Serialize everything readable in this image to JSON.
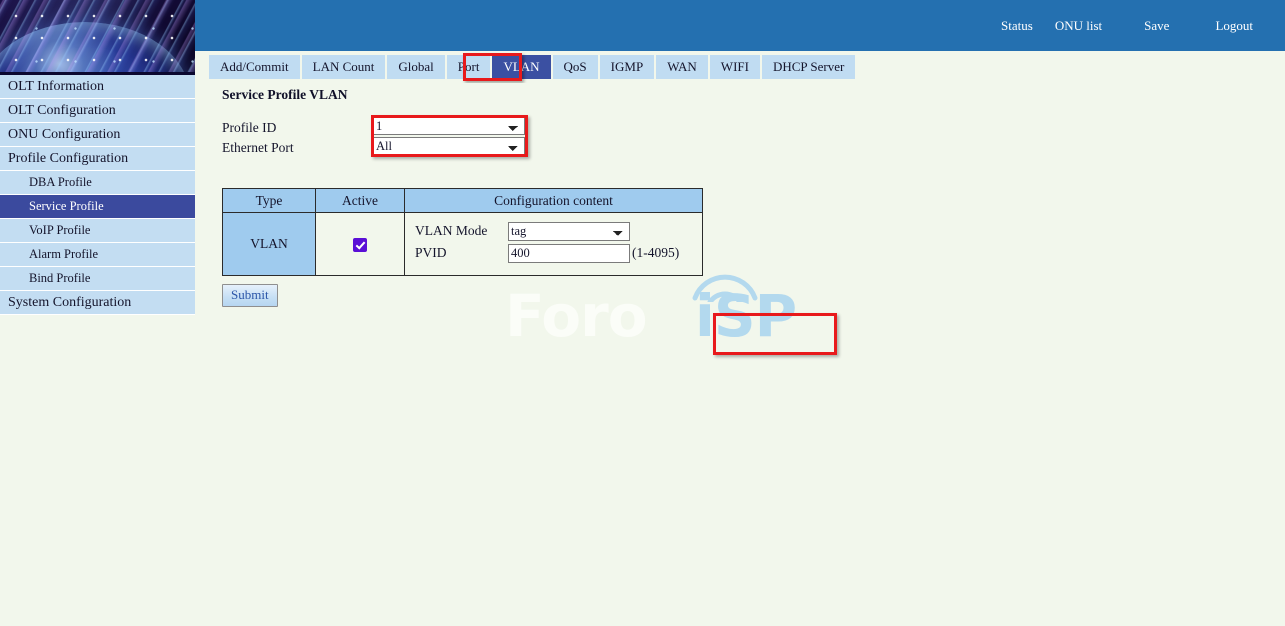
{
  "colors": {
    "header_blue": "#2470b0",
    "tab_blue": "#c0dcf2",
    "tab_active": "#3b50a2",
    "sidebar_blue": "#c3ddf2",
    "sidebar_selected": "#3b4a9e",
    "highlight_red": "#e8191b",
    "page_bg": "#f2f7ec",
    "table_header_blue": "#9fcbee",
    "checkbox_purple": "#5a0fd6",
    "watermark_blue": "#b3d9ee"
  },
  "banner": {
    "icon": "globe-fiber-banner-image"
  },
  "sidebar": {
    "items": [
      {
        "label": "OLT Information",
        "level": "top",
        "selected": false
      },
      {
        "label": "OLT Configuration",
        "level": "top",
        "selected": false
      },
      {
        "label": "ONU Configuration",
        "level": "top",
        "selected": false
      },
      {
        "label": "Profile Configuration",
        "level": "top",
        "selected": false
      },
      {
        "label": "DBA Profile",
        "level": "sub",
        "selected": false
      },
      {
        "label": "Service Profile",
        "level": "sub",
        "selected": true
      },
      {
        "label": "VoIP Profile",
        "level": "sub",
        "selected": false
      },
      {
        "label": "Alarm Profile",
        "level": "sub",
        "selected": false
      },
      {
        "label": "Bind Profile",
        "level": "sub",
        "selected": false
      },
      {
        "label": "System Configuration",
        "level": "top",
        "selected": false
      }
    ]
  },
  "header": {
    "links": [
      {
        "label": "Status"
      },
      {
        "label": "ONU list"
      },
      {
        "label": "Save"
      },
      {
        "label": "Logout"
      }
    ]
  },
  "tabs": [
    {
      "label": "Add/Commit",
      "active": false
    },
    {
      "label": "LAN Count",
      "active": false
    },
    {
      "label": "Global",
      "active": false
    },
    {
      "label": "Port",
      "active": false
    },
    {
      "label": "VLAN",
      "active": true
    },
    {
      "label": "QoS",
      "active": false
    },
    {
      "label": "IGMP",
      "active": false
    },
    {
      "label": "WAN",
      "active": false
    },
    {
      "label": "WIFI",
      "active": false
    },
    {
      "label": "DHCP Server",
      "active": false
    }
  ],
  "main": {
    "page_title": "Service Profile VLAN",
    "form": {
      "profile_id": {
        "label": "Profile ID",
        "value": "1",
        "options": [
          "1"
        ]
      },
      "ethernet_port": {
        "label": "Ethernet Port",
        "value": "All",
        "options": [
          "All"
        ]
      }
    },
    "table": {
      "columns": [
        "Type",
        "Active",
        "Configuration content"
      ],
      "row": {
        "type": "VLAN",
        "active": true,
        "config": {
          "vlan_mode": {
            "label": "VLAN Mode",
            "value": "tag",
            "options": [
              "tag"
            ]
          },
          "pvid": {
            "label": "PVID",
            "value": "400",
            "placeholder": "",
            "hint": "(1-4095)"
          }
        }
      }
    },
    "submit_label": "Submit"
  },
  "watermark": {
    "text_left": "Foro",
    "text_right": "iSP"
  }
}
